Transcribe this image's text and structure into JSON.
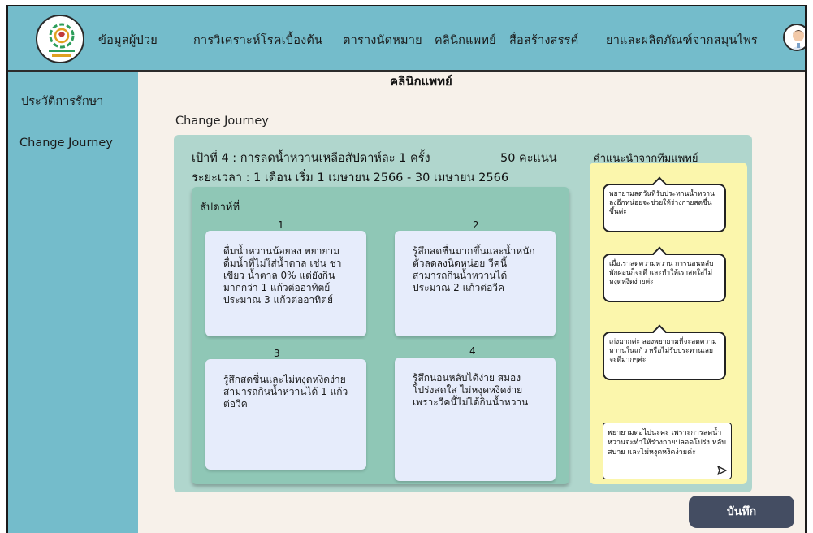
{
  "header": {
    "nav_items": [
      "ข้อมูลผู้ป่วย",
      "การวิเคราะห์โรคเบื้องต้น",
      "ตารางนัดหมาย",
      "คลินิกแพทย์",
      "สื่อสร้างสรรค์",
      "ยาและผลิตภัณฑ์จากสมุนไพร"
    ]
  },
  "sidebar": {
    "items": [
      "ประวัติการรักษา",
      "Change Journey"
    ]
  },
  "main": {
    "page_title": "คลินิกแพทย์",
    "section_title": "Change Journey",
    "goal": "เป้าที่ 4 : การลดน้ำหวานเหลือสัปดาห์ละ 1 ครั้ง",
    "points": "50 คะแนน",
    "period": "ระยะเวลา : 1 เดือน เริ่ม 1 เมษายน 2566 - 30 เมษายน 2566",
    "weeks_label": "สัปดาห์ที่",
    "weeks": [
      {
        "num": "1",
        "text": "ดื่มน้ำหวานน้อยลง พยายามดื่มน้ำที่ไม่ใส่น้ำตาล เช่น ชาเขียว น้ำตาล 0% แต่ยังกินมากกว่า 1 แก้วต่ออาทิตย์ ประมาณ 3 แก้วต่ออาทิตย์"
      },
      {
        "num": "2",
        "text": "รู้สึกสดชื่นมากขึ้นและน้ำหนักตัวลดลงนิดหน่อย วีคนี้สามารถกินน้ำหวานได้ประมาณ 2 แก้วต่อวีค"
      },
      {
        "num": "3",
        "text": "รู้สึกสดชื่นและไม่หงุดหงิดง่าย สามารถกินน้ำหวานได้ 1 แก้วต่อวีค"
      },
      {
        "num": "4",
        "text": "รู้สึกนอนหลับได้ง่าย สมองโปร่งสดใส ไม่หงุดหงิดง่าย เพราะวีคนี้ไม่ได้กินน้ำหวาน"
      }
    ]
  },
  "advice": {
    "title": "คำแนะนำจากทีมแพทย์",
    "messages": [
      "พยายามลดวันที่รับประทานน้ำหวานลงอีกหน่อยจะช่วยให้ร่างกายสดชื่นขึ้นค่ะ",
      "เมื่อเราลดความหวาน การนอนหลับพักผ่อนก็จะดี และทำให้เราสดใสไม่หงุดหงิดง่ายค่ะ",
      "เก่งมากค่ะ ลองพยายามที่จะลดความหวานในแก้ว หรือไม่รับประทานเลยจะดีมากๆค่ะ"
    ],
    "reply_text": "พยายามต่อไปนะคะ เพราะการลดน้ำหวานจะทำให้ร่างกายปลอดโปร่ง หลับสบาย และไม่หงุดหงิดง่ายค่ะ",
    "send_icon": "send-icon"
  },
  "actions": {
    "save_label": "บันทึก"
  },
  "colors": {
    "navbar": "#74bccb",
    "background": "#f7f1ea",
    "outer_panel": "#b0d6cd",
    "weeks_panel": "#8fc7b6",
    "week_card": "#e6ecfb",
    "advice_panel": "#fbf6ac",
    "save_button": "#444d62"
  }
}
